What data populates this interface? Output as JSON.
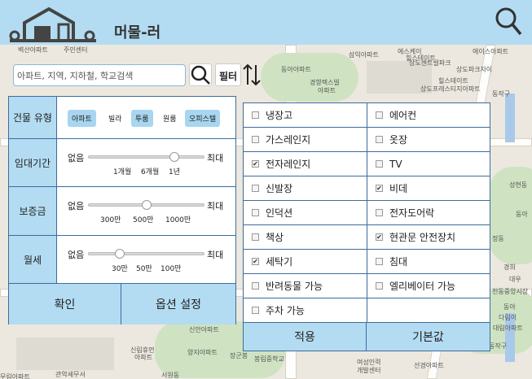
{
  "header": {
    "brand": "머물-러"
  },
  "search": {
    "placeholder": "아파트, 지역, 지하철, 학교검색",
    "filter_label": "필터"
  },
  "map_labels": [
    "벽산아파트",
    "주민센터",
    "삼익아파트",
    "에스케이",
    "에이스아파트",
    "동아아파트",
    "힐스테이트",
    "상도프레스티지아파트",
    "경향렉스빌",
    "아파트",
    "힐스테이트",
    "상도센트럴파크",
    "동작구",
    "상도파크자이",
    "성현동",
    "동아",
    "정동",
    "경희",
    "대우",
    "천동중앙시장",
    "동아",
    "다림이",
    "대림아파트",
    "신안아파트",
    "신림휴먼",
    "아파트",
    "양지아파트",
    "장군봉",
    "봉림중학교",
    "관악세무서",
    "서원동",
    "여성인력",
    "개발센터",
    "선경아파트",
    "동작구",
    "무림아파트"
  ],
  "filters": {
    "building_type": {
      "label": "건물 유형",
      "options": [
        {
          "label": "아파트",
          "selected": true
        },
        {
          "label": "빌라",
          "selected": false
        },
        {
          "label": "투룸",
          "selected": true
        },
        {
          "label": "원룸",
          "selected": false
        },
        {
          "label": "오피스텔",
          "selected": true
        }
      ]
    },
    "lease_period": {
      "label": "임대기간",
      "min": "없음",
      "max": "최대",
      "ticks": [
        "1개월",
        "6개월",
        "1년"
      ],
      "value_fraction": 0.73
    },
    "deposit": {
      "label": "보증금",
      "min": "없음",
      "max": "최대",
      "ticks": [
        "300만",
        "500만",
        "1000만"
      ],
      "value_fraction": 0.5
    },
    "monthly_rent": {
      "label": "월세",
      "min": "없음",
      "max": "최대",
      "ticks": [
        "30만",
        "50만",
        "100만"
      ],
      "value_fraction": 0.27
    },
    "confirm_label": "확인",
    "options_label": "옵션 설정"
  },
  "options": {
    "items": [
      {
        "label": "냉장고",
        "checked": false
      },
      {
        "label": "에어컨",
        "checked": false
      },
      {
        "label": "가스레인지",
        "checked": false
      },
      {
        "label": "옷장",
        "checked": false
      },
      {
        "label": "전자레인지",
        "checked": true
      },
      {
        "label": "TV",
        "checked": false
      },
      {
        "label": "신발장",
        "checked": false
      },
      {
        "label": "비데",
        "checked": true
      },
      {
        "label": "인덕션",
        "checked": false
      },
      {
        "label": "전자도어락",
        "checked": false
      },
      {
        "label": "책상",
        "checked": false
      },
      {
        "label": "현관문 안전장치",
        "checked": true
      },
      {
        "label": "세탁기",
        "checked": true
      },
      {
        "label": "침대",
        "checked": false
      },
      {
        "label": "반려동물 가능",
        "checked": false
      },
      {
        "label": "엘리베이터 가능",
        "checked": false
      },
      {
        "label": "주차 가능",
        "checked": false
      }
    ],
    "apply_label": "적용",
    "reset_label": "기본값"
  },
  "colors": {
    "accent": "#b3dcf2",
    "border": "#3d6c9c"
  }
}
